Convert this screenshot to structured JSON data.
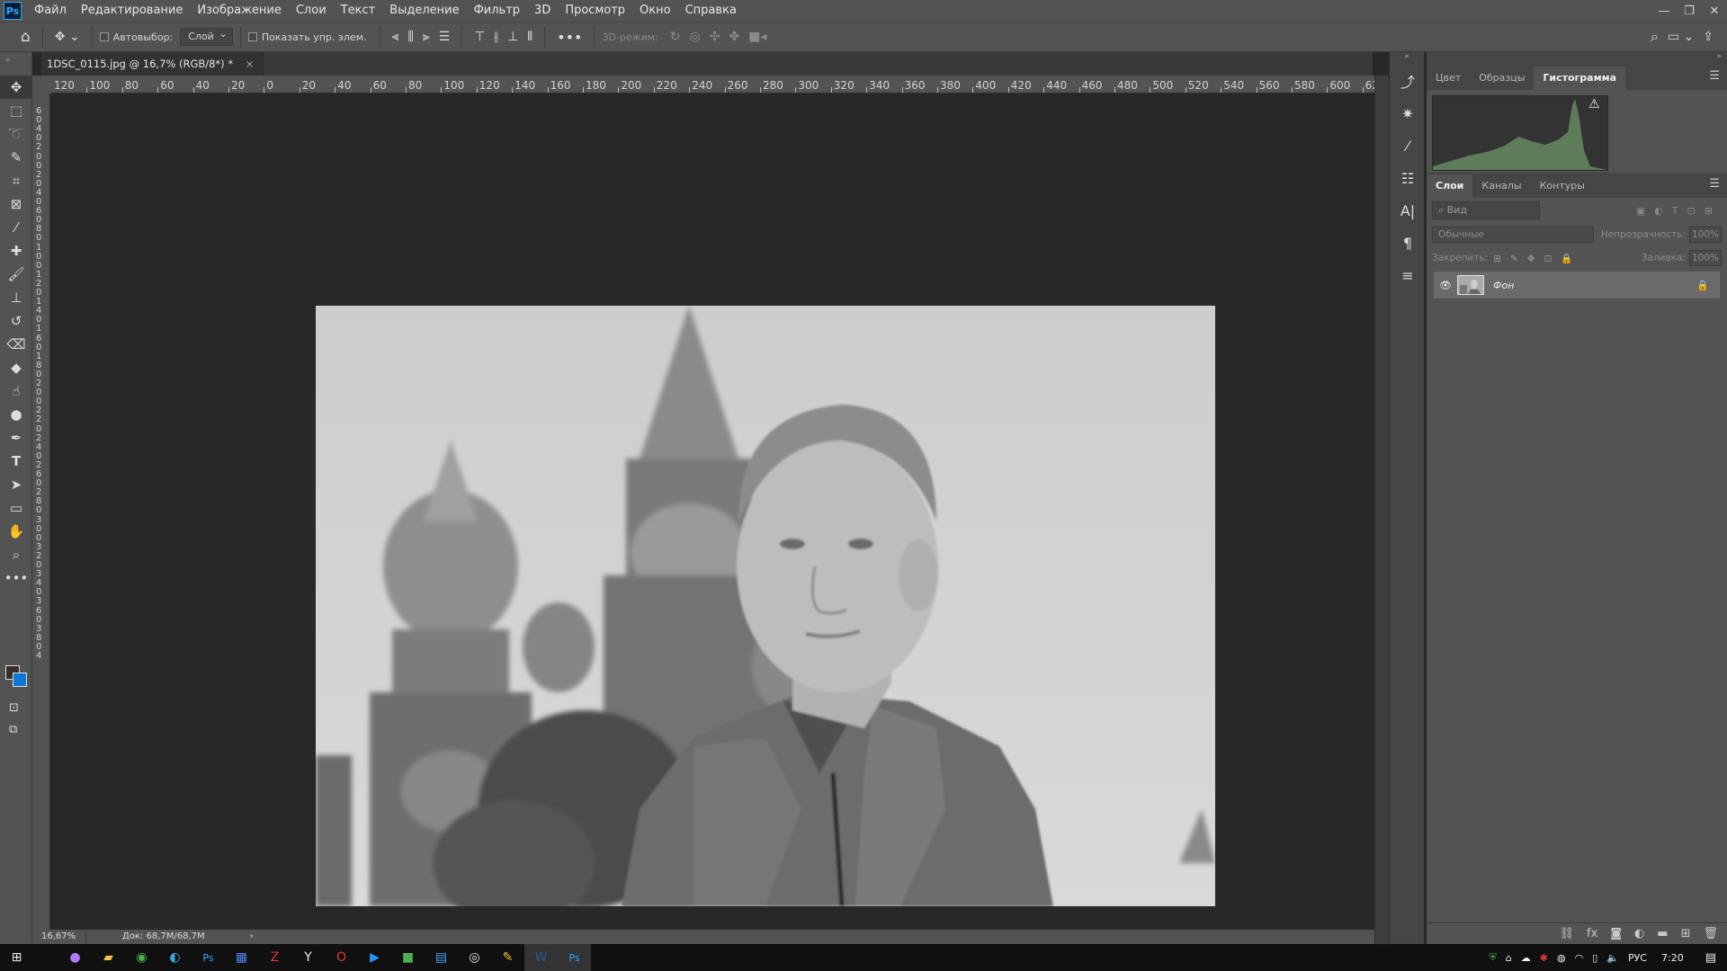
{
  "menu": {
    "items": [
      "Файл",
      "Редактирование",
      "Изображение",
      "Слои",
      "Текст",
      "Выделение",
      "Фильтр",
      "3D",
      "Просмотр",
      "Окно",
      "Справка"
    ],
    "logo": "Ps"
  },
  "options": {
    "autoselect_label": "Автовыбор:",
    "autoselect_value": "Слой",
    "show_transform_label": "Показать упр. элем.",
    "mode3d_label": "3D-режим:"
  },
  "document": {
    "tab_title": "1DSC_0115.jpg @ 16,7% (RGB/8*) *"
  },
  "ruler": {
    "h_ticks": [
      "120",
      "100",
      "80",
      "60",
      "40",
      "20",
      "0",
      "20",
      "40",
      "60",
      "80",
      "100",
      "120",
      "140",
      "160",
      "180",
      "200",
      "220",
      "240",
      "260",
      "280",
      "300",
      "320",
      "340",
      "360",
      "380",
      "400",
      "420",
      "440",
      "460",
      "480",
      "500",
      "520",
      "540",
      "560",
      "580",
      "600",
      "62"
    ],
    "v_ticks": [
      "6",
      "0",
      "4",
      "0",
      "2",
      "0",
      "0",
      "2",
      "0",
      "4",
      "0",
      "6",
      "0",
      "8",
      "0",
      "1",
      "0",
      "0",
      "1",
      "2",
      "0",
      "1",
      "4",
      "0",
      "1",
      "6",
      "0",
      "1",
      "8",
      "0",
      "2",
      "0",
      "0",
      "2",
      "2",
      "0",
      "2",
      "4",
      "0",
      "2",
      "6",
      "0",
      "2",
      "8",
      "0",
      "3",
      "0",
      "0",
      "3",
      "2",
      "0",
      "3",
      "4",
      "0",
      "3",
      "6",
      "0",
      "3",
      "8",
      "0",
      "4"
    ]
  },
  "status": {
    "zoom": "16,67%",
    "doc_size": "Док: 68,7M/68,7M",
    "arrow": "›"
  },
  "panels": {
    "top_tabs": [
      "Цвет",
      "Образцы",
      "Гистограмма"
    ],
    "top_active": 2,
    "layer_tabs": [
      "Слои",
      "Каналы",
      "Контуры"
    ],
    "layer_active": 0,
    "search_placeholder": "Вид",
    "blend_mode": "Обычные",
    "opacity_label": "Непрозрачность:",
    "opacity_value": "100%",
    "lock_label": "Закрепить:",
    "fill_label": "Заливка:",
    "fill_value": "100%",
    "layer_name": "Фон"
  },
  "colors": {
    "foreground": "#3b2c26",
    "background": "#0d78d6",
    "accent": "#31a8ff"
  },
  "taskbar": {
    "lang": "РУС",
    "time": "7:20"
  }
}
